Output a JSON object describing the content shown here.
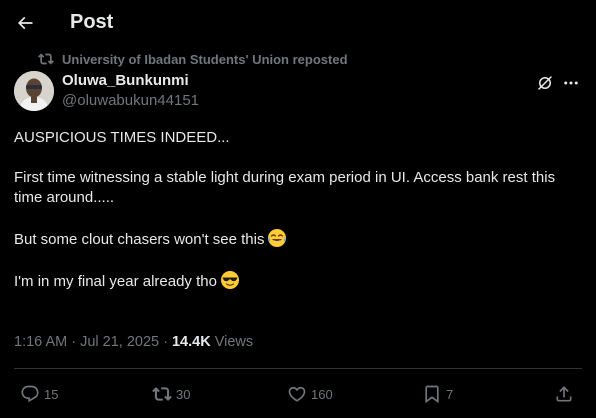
{
  "header": {
    "back_icon": "arrow-left-icon",
    "title": "Post"
  },
  "repost": {
    "icon": "repost-icon",
    "text": "University of Ibadan Students' Union reposted"
  },
  "author": {
    "name": "Oluwa_Bunkunmi",
    "handle": "@oluwabukun44151",
    "avatar_icon": "avatar"
  },
  "post": {
    "lines": [
      "AUSPICIOUS TIMES INDEED...",
      "First time witnessing a stable light during exam period in UI. Access bank rest this time around.....",
      "But some clout chasers won't see this",
      "I'm in my final year already tho"
    ],
    "emoji_1": "tears-of-joy-emoji",
    "emoji_2": "sunglasses-emoji"
  },
  "meta": {
    "timestamp": "1:16 AM · Jul 21, 2025 · ",
    "views_count": "14.4K",
    "views_label": " Views"
  },
  "actions": {
    "replies": "15",
    "reposts": "30",
    "likes": "160",
    "bookmarks": "7"
  },
  "colors": {
    "background": "#000000",
    "text": "#e7e9ea",
    "muted": "#71767b",
    "border": "#2f3336"
  }
}
